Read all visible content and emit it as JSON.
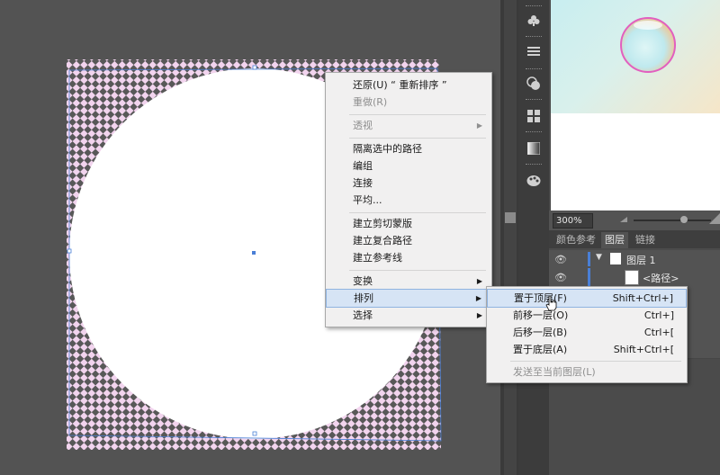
{
  "context_menu": {
    "items": [
      {
        "label": "还原(U) “ 重新排序 ”",
        "disabled": false
      },
      {
        "label": "重做(R)",
        "disabled": true
      },
      {
        "label": "透视",
        "disabled": true,
        "submenu": true
      },
      {
        "label": "隔离选中的路径",
        "disabled": false
      },
      {
        "label": "编组",
        "disabled": false
      },
      {
        "label": "连接",
        "disabled": false
      },
      {
        "label": "平均...",
        "disabled": false
      },
      {
        "label": "建立剪切蒙版",
        "disabled": false
      },
      {
        "label": "建立复合路径",
        "disabled": false
      },
      {
        "label": "建立参考线",
        "disabled": false
      },
      {
        "label": "变换",
        "disabled": false,
        "submenu": true
      },
      {
        "label": "排列",
        "disabled": false,
        "submenu": true,
        "highlighted": true
      },
      {
        "label": "选择",
        "disabled": false,
        "submenu": true
      }
    ]
  },
  "arrange_submenu": {
    "items": [
      {
        "label": "置于顶层(F)",
        "shortcut": "Shift+Ctrl+]",
        "highlighted": true
      },
      {
        "label": "前移一层(O)",
        "shortcut": "Ctrl+]"
      },
      {
        "label": "后移一层(B)",
        "shortcut": "Ctrl+["
      },
      {
        "label": "置于底层(A)",
        "shortcut": "Shift+Ctrl+["
      },
      {
        "label": "发送至当前图层(L)",
        "shortcut": "",
        "disabled": true
      }
    ]
  },
  "panel": {
    "zoom": "300%",
    "tabs": [
      "颜色参考",
      "图层",
      "链接"
    ],
    "active_tab": "图层",
    "layer_name": "图层 1",
    "sublayer_name": "<路径>"
  },
  "toolstrip": {
    "icons": [
      "club-icon",
      "lines-icon",
      "circles-icon",
      "grid-icon",
      "gradient-icon",
      "palette-icon"
    ]
  },
  "colors": {
    "canvas_bg": "#535353",
    "checker_light": "#f2d4ee",
    "checker_dark": "#585858",
    "selection": "#4a7fd6",
    "menu_bg": "#f1f0f0",
    "menu_highlight": "#d6e4f5"
  }
}
